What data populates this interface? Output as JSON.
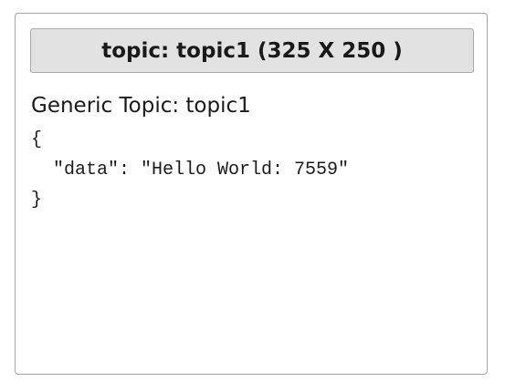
{
  "panel": {
    "title": "topic: topic1 (325 X 250 )",
    "topic_label": "Generic Topic: topic1",
    "json_lines": [
      "{",
      "  \"data\": \"Hello World: 7559\"",
      "}"
    ]
  }
}
